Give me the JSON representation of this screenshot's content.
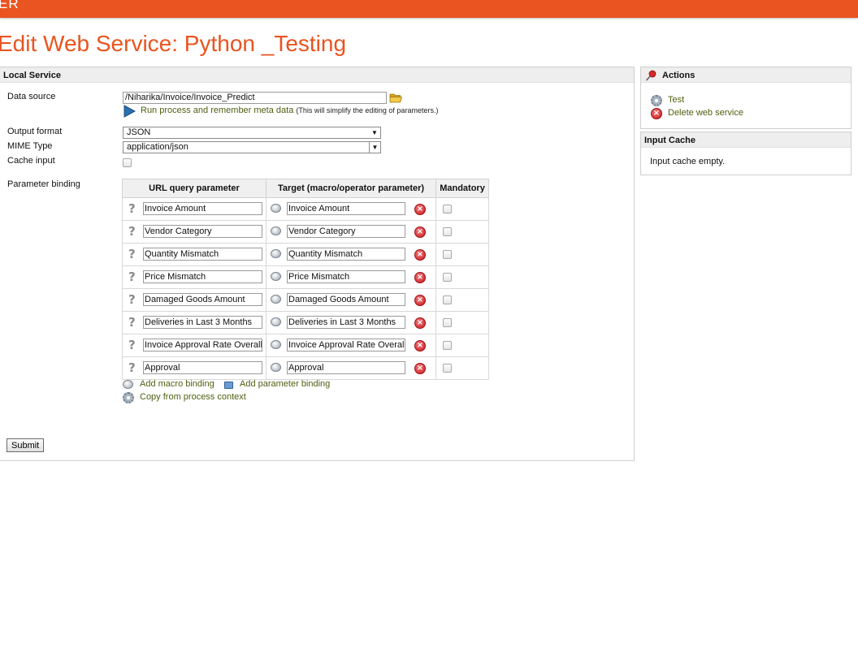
{
  "app": {
    "brand_fragment": "ER"
  },
  "page": {
    "title": "Edit Web Service: Python _Testing"
  },
  "local_service": {
    "heading": "Local Service",
    "data_source": {
      "label": "Data source",
      "value": "/Niharika/Invoice/Invoice_Predict",
      "run_link": "Run process and remember meta data",
      "run_note": "(This will simplify the editing of parameters.)"
    },
    "output_format": {
      "label": "Output format",
      "value": "JSON"
    },
    "mime_type": {
      "label": "MIME Type",
      "value": "application/json"
    },
    "cache_input": {
      "label": "Cache input",
      "checked": false
    },
    "parameter_binding": {
      "label": "Parameter binding",
      "headers": [
        "URL query parameter",
        "Target (macro/operator parameter)",
        "Mandatory"
      ],
      "rows": [
        {
          "url_param": "Invoice Amount",
          "target": "Invoice Amount",
          "mandatory": false
        },
        {
          "url_param": "Vendor Category",
          "target": "Vendor Category",
          "mandatory": false
        },
        {
          "url_param": "Quantity Mismatch",
          "target": "Quantity Mismatch",
          "mandatory": false
        },
        {
          "url_param": "Price Mismatch",
          "target": "Price Mismatch",
          "mandatory": false
        },
        {
          "url_param": "Damaged Goods Amount",
          "target": "Damaged Goods Amount",
          "mandatory": false
        },
        {
          "url_param": "Deliveries in Last 3 Months",
          "target": "Deliveries in Last 3 Months",
          "mandatory": false
        },
        {
          "url_param": "Invoice Approval Rate Overall",
          "target": "Invoice Approval Rate Overall",
          "mandatory": false
        },
        {
          "url_param": "Approval",
          "target": "Approval",
          "mandatory": false
        }
      ],
      "add_macro_binding": "Add macro binding",
      "add_parameter_binding": "Add parameter binding",
      "copy_from_context": "Copy from process context"
    },
    "submit_label": "Submit"
  },
  "actions": {
    "heading": "Actions",
    "test_label": "Test",
    "delete_label": "Delete web service"
  },
  "input_cache": {
    "heading": "Input Cache",
    "message": "Input cache empty."
  },
  "colors": {
    "brand": "#e95420",
    "link": "#4e5f10",
    "delete": "#c8161d"
  },
  "icons": {
    "data_source_browse": "folder-open-icon",
    "run": "play-arrow-icon",
    "help": "question-mark-icon",
    "macro": "macro-icon",
    "delete": "delete-icon",
    "pin": "pushpin-icon",
    "gear": "gear-icon"
  }
}
